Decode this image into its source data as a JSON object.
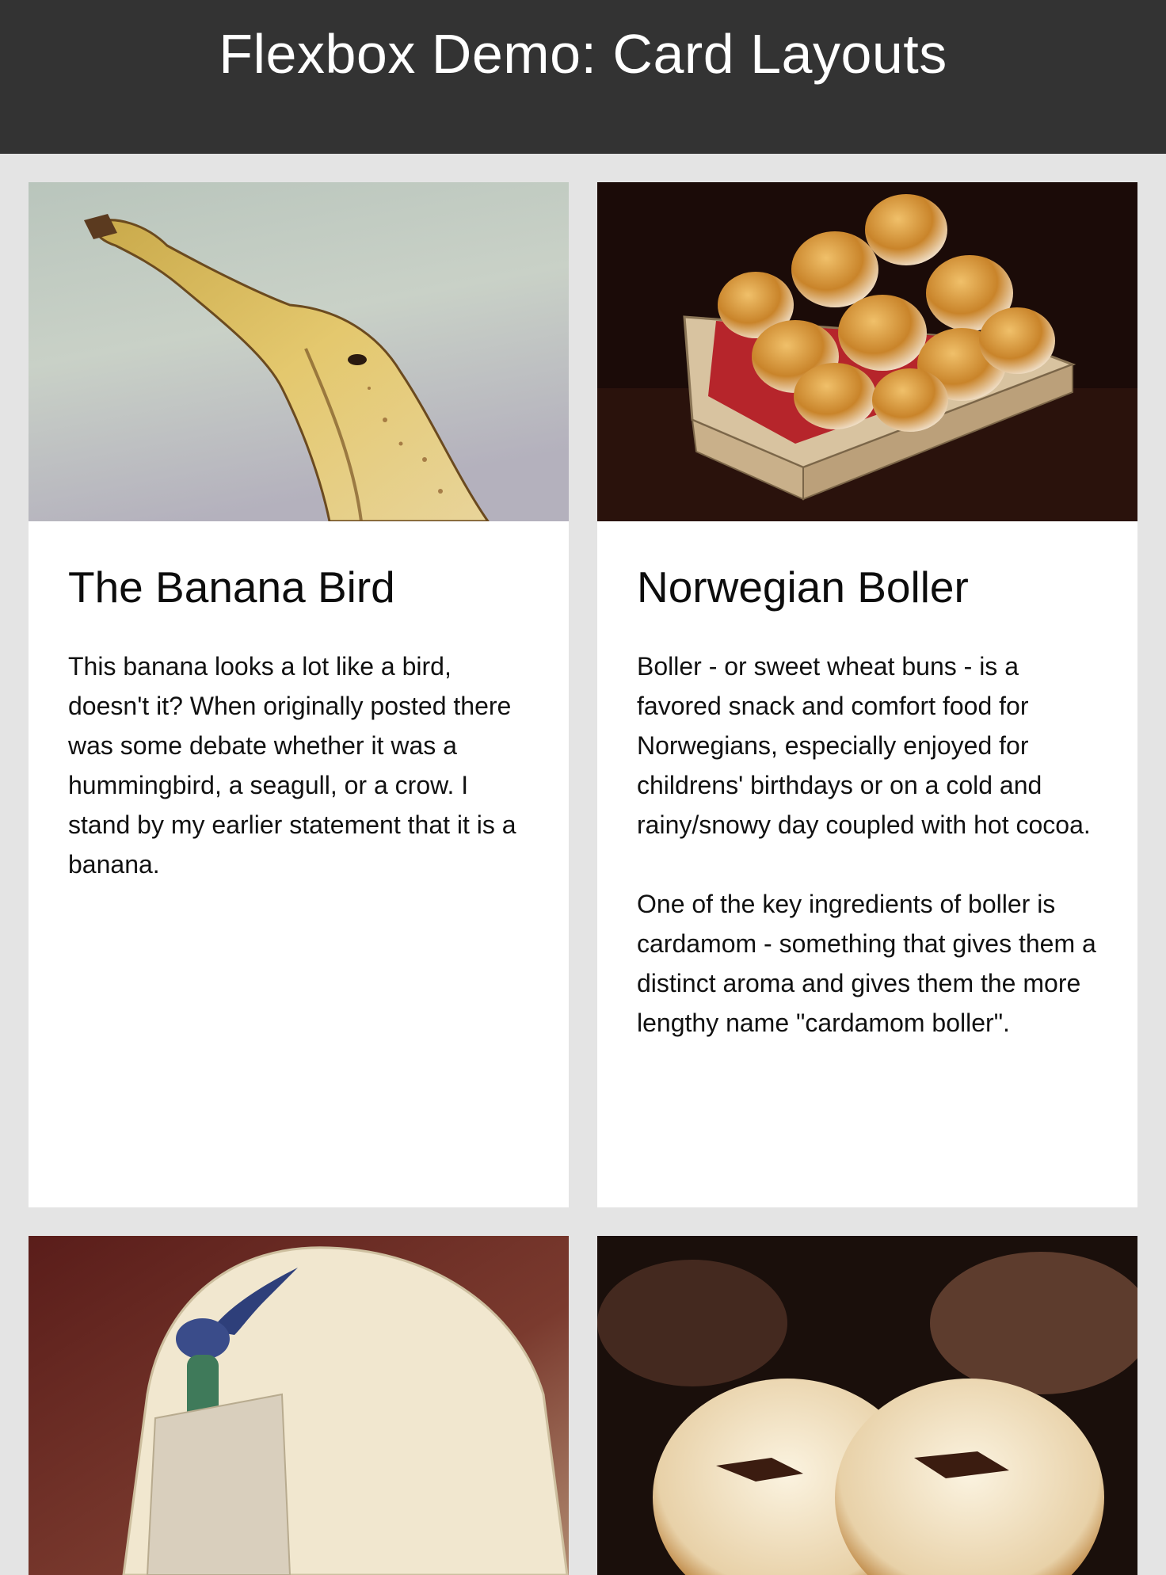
{
  "header": {
    "title": "Flexbox Demo: Card Layouts"
  },
  "cards": [
    {
      "image_icon": "banana-photo",
      "title": "The Banana Bird",
      "paragraphs": [
        "This banana looks a lot like a bird, doesn't it? When originally posted there was some debate whether it was a hummingbird, a seagull, or a crow. I stand by my earlier statement that it is a banana."
      ]
    },
    {
      "image_icon": "boller-basket-photo",
      "title": "Norwegian Boller",
      "paragraphs": [
        "Boller - or sweet wheat buns - is a favored snack and comfort food for Norwegians, especially enjoyed for childrens' birthdays or on a cold and rainy/snowy day coupled with hot cocoa.",
        "One of the key ingredients of boller is cardamom - something that gives them a distinct aroma and gives them the more lengthy name \"cardamom boller\"."
      ]
    },
    {
      "image_icon": "dinosaur-toy-photo"
    },
    {
      "image_icon": "chocolate-bun-photo"
    }
  ]
}
